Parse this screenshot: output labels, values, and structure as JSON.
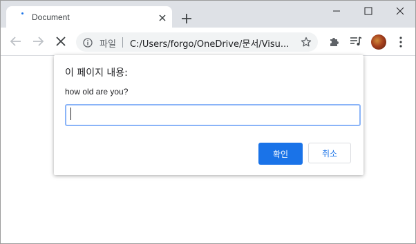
{
  "colors": {
    "tabstrip_bg": "#dee1e6",
    "accent": "#1a73e8",
    "input_border": "#8ab4f8",
    "omnibox_bg": "#f1f3f4"
  },
  "tab": {
    "title": "Document",
    "loading": true
  },
  "window_controls": [
    "minimize-icon",
    "maximize-icon",
    "close-icon"
  ],
  "toolbar": {
    "site_label": "파일",
    "url": "C:/Users/forgo/OneDrive/문서/Visu...",
    "icons": [
      "back-arrow-icon",
      "forward-arrow-icon",
      "stop-loading-icon",
      "info-icon",
      "star-icon",
      "puzzle-extensions-icon",
      "media-queue-icon",
      "avatar",
      "kebab-menu-icon"
    ]
  },
  "dialog": {
    "title": "이 페이지 내용:",
    "message": "how old are you?",
    "input_value": "",
    "ok_label": "확인",
    "cancel_label": "취소"
  }
}
